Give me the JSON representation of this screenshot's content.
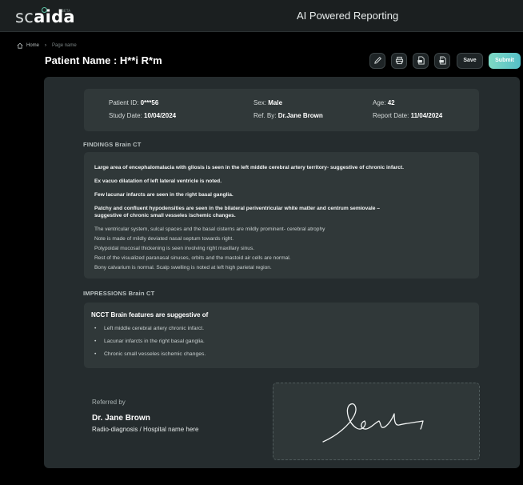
{
  "app": {
    "logo_prefix": "sc",
    "logo_suffix": "aida",
    "logo_badge": "BETA",
    "title": "AI Powered Reporting"
  },
  "breadcrumb": {
    "home": "Home",
    "separator": "›",
    "current": "Page name"
  },
  "header": {
    "patient_title": "Patient Name : H**i R*m",
    "save_label": "Save",
    "submit_label": "Submit"
  },
  "patient_info": {
    "patient_id_label": "Patient ID:",
    "patient_id": "0***56",
    "sex_label": "Sex:",
    "sex": "Male",
    "age_label": "Age:",
    "age": "42",
    "study_date_label": "Study Date:",
    "study_date": "10/04/2024",
    "ref_by_label": "Ref. By:",
    "ref_by": "Dr.Jane Brown",
    "report_date_label": "Report Date:",
    "report_date": "11/04/2024"
  },
  "findings": {
    "label": "FINDINGS Brain CT",
    "bold_items": [
      "Large area of encephalomalacia with gliosis is seen in the left middle cerebral artery territory- suggestive of chronic infarct.",
      "Ex vacuo dilatation of left lateral ventricle is noted.",
      "Few lacunar infarcts are seen in the right basal ganglia.",
      "Patchy and confluent hypodensities are seen in the bilateral periventricular white matter and centrum semiovale – suggestive of chronic small vesseles ischemic changes."
    ],
    "normal_items": [
      "The ventricular system, sulcal spaces and the basal cisterns are mildly prominent- cerebral atrophy",
      "Note is made of mildly deviated nasal septum towards right.",
      "Polypoidal mucosal thickening is seen involving right maxillary sinus.",
      "Rest of the visualized paranasal sinuses, orbits and the mastoid air cells are normal.",
      "Bony calvarium is normal. Scalp swelling is noted at left high parietal region."
    ]
  },
  "impressions": {
    "label": "IMPRESSIONS Brain CT",
    "heading": "NCCT Brain features are suggestive of",
    "bullet": "•",
    "items": [
      "Left middle cerebral artery chronic infarct.",
      "Lacunar infarcts in the right basal ganglia.",
      "Chronic small vesseles ischemic changes."
    ]
  },
  "referral": {
    "label": "Referred by",
    "doctor": "Dr. Jane Brown",
    "department": "Radio-diagnosis / Hospital name here"
  },
  "colors": {
    "accent": "#5ec6a8",
    "submit_gradient_start": "#7fd9c4",
    "submit_gradient_end": "#55c0c8",
    "panel": "#252c2e",
    "card": "#303839"
  },
  "icons": {
    "edit": "pencil-icon",
    "print": "printer-icon",
    "pdf": "pdf-file-icon",
    "doc": "document-icon",
    "home": "home-icon"
  }
}
